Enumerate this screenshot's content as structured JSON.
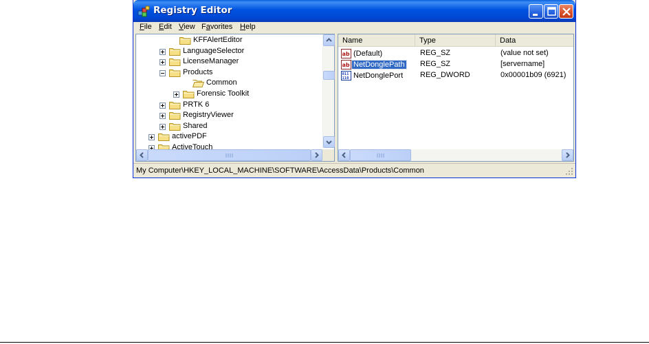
{
  "window": {
    "title": "Registry Editor",
    "icon": "registry-editor-icon",
    "colors": {
      "titlebar": "#0052e0",
      "selection": "#316ac5",
      "close_button": "#d8502a"
    }
  },
  "menu": {
    "items": [
      {
        "label": "File",
        "u": "F",
        "rest": "ile"
      },
      {
        "label": "Edit",
        "u": "E",
        "rest": "dit"
      },
      {
        "label": "View",
        "u": "V",
        "rest": "iew"
      },
      {
        "label": "Favorites",
        "u": "",
        "pre": "F",
        "ul": "a",
        "rest": "vorites"
      },
      {
        "label": "Help",
        "u": "H",
        "rest": "elp"
      }
    ]
  },
  "tree": {
    "items": [
      {
        "label": "KFFAlertEditor",
        "expander": "none",
        "open": false
      },
      {
        "label": "LanguageSelector",
        "expander": "plus",
        "open": false
      },
      {
        "label": "LicenseManager",
        "expander": "plus",
        "open": false
      },
      {
        "label": "Products",
        "expander": "minus",
        "open": false
      },
      {
        "label": "Common",
        "expander": "none",
        "open": true
      },
      {
        "label": "Forensic Toolkit",
        "expander": "plus",
        "open": false
      },
      {
        "label": "PRTK 6",
        "expander": "plus",
        "open": false
      },
      {
        "label": "RegistryViewer",
        "expander": "plus",
        "open": false
      },
      {
        "label": "Shared",
        "expander": "plus",
        "open": false
      },
      {
        "label": "activePDF",
        "expander": "plus",
        "open": false
      },
      {
        "label": "ActiveTouch",
        "expander": "plus",
        "open": false
      }
    ]
  },
  "values_list": {
    "columns": [
      "Name",
      "Type",
      "Data"
    ],
    "rows": [
      {
        "name": "(Default)",
        "type": "REG_SZ",
        "data": "(value not set)",
        "icon": "string-value-icon",
        "selected": false
      },
      {
        "name": "NetDonglePath",
        "type": "REG_SZ",
        "data": "[servername]",
        "icon": "string-value-icon",
        "selected": true
      },
      {
        "name": "NetDonglePort",
        "type": "REG_DWORD",
        "data": "0x00001b09 (6921)",
        "icon": "dword-value-icon",
        "selected": false
      }
    ]
  },
  "status": {
    "path": "My Computer\\HKEY_LOCAL_MACHINE\\SOFTWARE\\AccessData\\Products\\Common"
  }
}
